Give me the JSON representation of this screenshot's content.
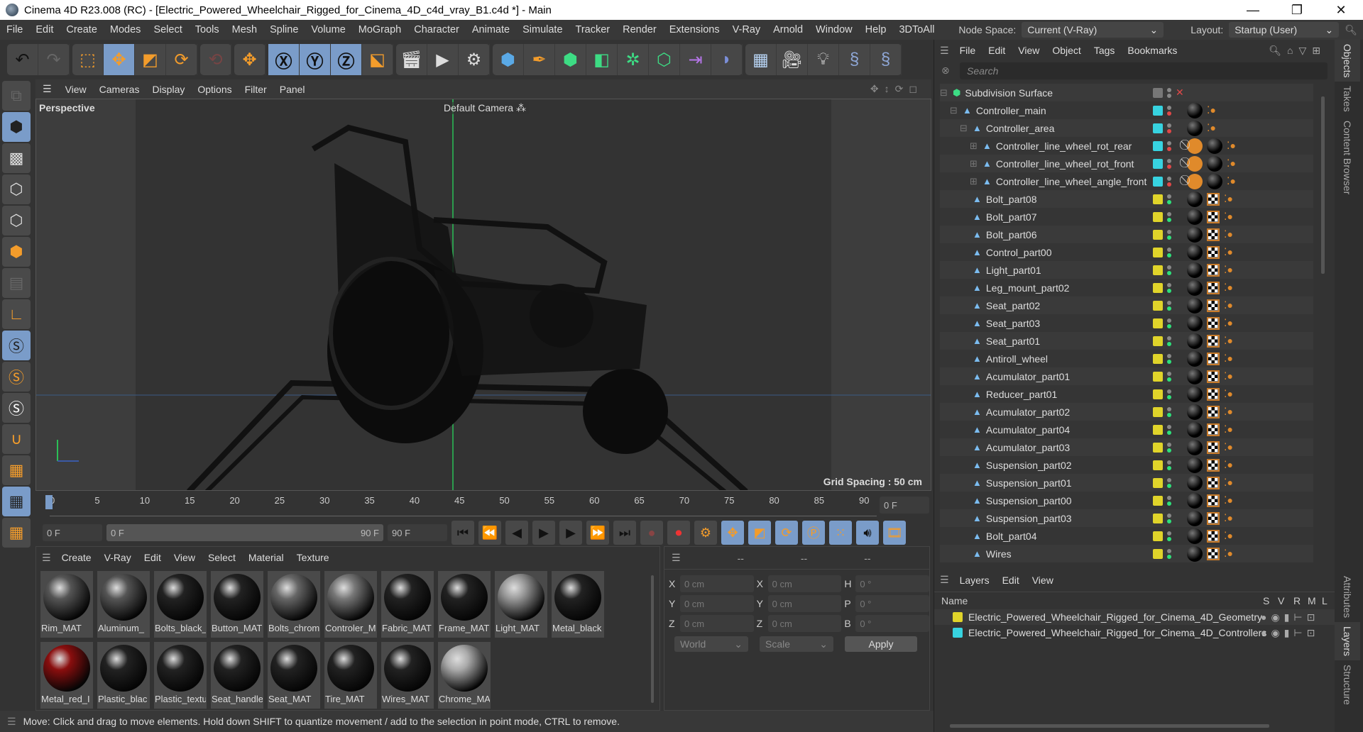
{
  "window": {
    "title": "Cinema 4D R23.008 (RC) - [Electric_Powered_Wheelchair_Rigged_for_Cinema_4D_c4d_vray_B1.c4d *] - Main",
    "controls": [
      "—",
      "❐",
      "✕"
    ]
  },
  "menubar": {
    "items": [
      "File",
      "Edit",
      "Create",
      "Modes",
      "Select",
      "Tools",
      "Mesh",
      "Spline",
      "Volume",
      "MoGraph",
      "Character",
      "Animate",
      "Simulate",
      "Tracker",
      "Render",
      "Extensions",
      "V-Ray",
      "Arnold",
      "Window",
      "Help",
      "3DToAll"
    ],
    "node_space_label": "Node Space:",
    "node_space_value": "Current (V-Ray)",
    "layout_label": "Layout:",
    "layout_value": "Startup (User)"
  },
  "toolbar": {
    "icons": [
      "undo-icon",
      "redo-icon",
      "select-icon",
      "move-icon",
      "scale-icon",
      "rotate-icon",
      "psr-icon",
      "transform-icon",
      "x-axis-icon",
      "y-axis-icon",
      "z-axis-icon",
      "coord-system-icon",
      "render-view-icon",
      "render-icon",
      "render-settings-icon",
      "cube-icon",
      "pen-icon",
      "subdivision-icon",
      "extrude-icon",
      "cloner-icon",
      "mograph-icon",
      "deformer-icon",
      "bend-icon",
      "floor-icon",
      "camera-icon",
      "light-icon",
      "python-icon",
      "python2-icon"
    ]
  },
  "viewport": {
    "menu": [
      "View",
      "Cameras",
      "Display",
      "Options",
      "Filter",
      "Panel"
    ],
    "view_name": "Perspective",
    "camera": "Default Camera",
    "grid_spacing": "Grid Spacing : 50 cm"
  },
  "timeline": {
    "ticks": [
      "0",
      "5",
      "10",
      "15",
      "20",
      "25",
      "30",
      "35",
      "40",
      "45",
      "50",
      "55",
      "60",
      "65",
      "70",
      "75",
      "80",
      "85",
      "90"
    ],
    "current_frame": "0 F",
    "start": "0 F",
    "range_start": "0 F",
    "range_end": "90 F",
    "end": "90 F"
  },
  "materials": {
    "menu": [
      "Create",
      "V-Ray",
      "Edit",
      "View",
      "Select",
      "Material",
      "Texture"
    ],
    "items": [
      {
        "name": "Rim_MAT",
        "color": "#555"
      },
      {
        "name": "Aluminum_",
        "color": "#555"
      },
      {
        "name": "Bolts_black_",
        "color": "#222"
      },
      {
        "name": "Button_MAT",
        "color": "#222"
      },
      {
        "name": "Bolts_chrom",
        "color": "#666"
      },
      {
        "name": "Controler_M",
        "color": "#777"
      },
      {
        "name": "Fabric_MAT",
        "color": "#222"
      },
      {
        "name": "Frame_MAT",
        "color": "#222"
      },
      {
        "name": "Light_MAT",
        "color": "#999"
      },
      {
        "name": "Metal_black",
        "color": "#222"
      },
      {
        "name": "Metal_red_I",
        "color": "#8a0e0e"
      },
      {
        "name": "Plastic_blac",
        "color": "#222"
      },
      {
        "name": "Plastic_textu",
        "color": "#222"
      },
      {
        "name": "Seat_handle",
        "color": "#222"
      },
      {
        "name": "Seat_MAT",
        "color": "#222"
      },
      {
        "name": "Tire_MAT",
        "color": "#222"
      },
      {
        "name": "Wires_MAT",
        "color": "#222"
      },
      {
        "name": "Chrome_MA",
        "color": "#aaa"
      }
    ]
  },
  "coordinates": {
    "headers": [
      "--",
      "--",
      "--"
    ],
    "rows": [
      {
        "a": "X",
        "v1": "0 cm",
        "b": "X",
        "v2": "0 cm",
        "c": "H",
        "v3": "0 °"
      },
      {
        "a": "Y",
        "v1": "0 cm",
        "b": "Y",
        "v2": "0 cm",
        "c": "P",
        "v3": "0 °"
      },
      {
        "a": "Z",
        "v1": "0 cm",
        "b": "Z",
        "v2": "0 cm",
        "c": "B",
        "v3": "0 °"
      }
    ],
    "space": "World",
    "mode": "Scale",
    "apply": "Apply"
  },
  "objects": {
    "menu": [
      "File",
      "Edit",
      "View",
      "Object",
      "Tags",
      "Bookmarks"
    ],
    "search_placeholder": "Search",
    "items": [
      {
        "name": "Subdivision Surface",
        "indent": 0,
        "color": "",
        "expand": "⊟"
      },
      {
        "name": "Controller_main",
        "indent": 1,
        "color": "#37d3e0",
        "expand": "⊟"
      },
      {
        "name": "Controller_area",
        "indent": 2,
        "color": "#37d3e0",
        "expand": "⊟"
      },
      {
        "name": "Controller_line_wheel_rot_rear",
        "indent": 3,
        "color": "#37d3e0",
        "expand": "⊞"
      },
      {
        "name": "Controller_line_wheel_rot_front",
        "indent": 3,
        "color": "#37d3e0",
        "expand": "⊞"
      },
      {
        "name": "Controller_line_wheel_angle_front",
        "indent": 3,
        "color": "#37d3e0",
        "expand": "⊞"
      },
      {
        "name": "Bolt_part08",
        "indent": 2,
        "color": "#e0d42a",
        "expand": ""
      },
      {
        "name": "Bolt_part07",
        "indent": 2,
        "color": "#e0d42a",
        "expand": ""
      },
      {
        "name": "Bolt_part06",
        "indent": 2,
        "color": "#e0d42a",
        "expand": ""
      },
      {
        "name": "Control_part00",
        "indent": 2,
        "color": "#e0d42a",
        "expand": ""
      },
      {
        "name": "Light_part01",
        "indent": 2,
        "color": "#e0d42a",
        "expand": ""
      },
      {
        "name": "Leg_mount_part02",
        "indent": 2,
        "color": "#e0d42a",
        "expand": ""
      },
      {
        "name": "Seat_part02",
        "indent": 2,
        "color": "#e0d42a",
        "expand": ""
      },
      {
        "name": "Seat_part03",
        "indent": 2,
        "color": "#e0d42a",
        "expand": ""
      },
      {
        "name": "Seat_part01",
        "indent": 2,
        "color": "#e0d42a",
        "expand": ""
      },
      {
        "name": "Antiroll_wheel",
        "indent": 2,
        "color": "#e0d42a",
        "expand": ""
      },
      {
        "name": "Acumulator_part01",
        "indent": 2,
        "color": "#e0d42a",
        "expand": ""
      },
      {
        "name": "Reducer_part01",
        "indent": 2,
        "color": "#e0d42a",
        "expand": ""
      },
      {
        "name": "Acumulator_part02",
        "indent": 2,
        "color": "#e0d42a",
        "expand": ""
      },
      {
        "name": "Acumulator_part04",
        "indent": 2,
        "color": "#e0d42a",
        "expand": ""
      },
      {
        "name": "Acumulator_part03",
        "indent": 2,
        "color": "#e0d42a",
        "expand": ""
      },
      {
        "name": "Suspension_part02",
        "indent": 2,
        "color": "#e0d42a",
        "expand": ""
      },
      {
        "name": "Suspension_part01",
        "indent": 2,
        "color": "#e0d42a",
        "expand": ""
      },
      {
        "name": "Suspension_part00",
        "indent": 2,
        "color": "#e0d42a",
        "expand": ""
      },
      {
        "name": "Suspension_part03",
        "indent": 2,
        "color": "#e0d42a",
        "expand": ""
      },
      {
        "name": "Bolt_part04",
        "indent": 2,
        "color": "#e0d42a",
        "expand": ""
      },
      {
        "name": "Wires",
        "indent": 2,
        "color": "#e0d42a",
        "expand": ""
      }
    ]
  },
  "layers": {
    "menu": [
      "Layers",
      "Edit",
      "View"
    ],
    "columns": {
      "name": "Name",
      "s": "S",
      "v": "V",
      "r": "R",
      "m": "M",
      "l": "L"
    },
    "items": [
      {
        "name": "Electric_Powered_Wheelchair_Rigged_for_Cinema_4D_Geometry",
        "color": "#e0d42a"
      },
      {
        "name": "Electric_Powered_Wheelchair_Rigged_for_Cinema_4D_Controllers",
        "color": "#37d3e0"
      }
    ]
  },
  "side_tabs": {
    "top": [
      "Objects",
      "Takes",
      "Content Browser"
    ],
    "bottom": [
      "Attributes",
      "Layers",
      "Structure"
    ]
  },
  "status": "Move: Click and drag to move elements. Hold down SHIFT to quantize movement / add to the selection in point mode, CTRL to remove."
}
